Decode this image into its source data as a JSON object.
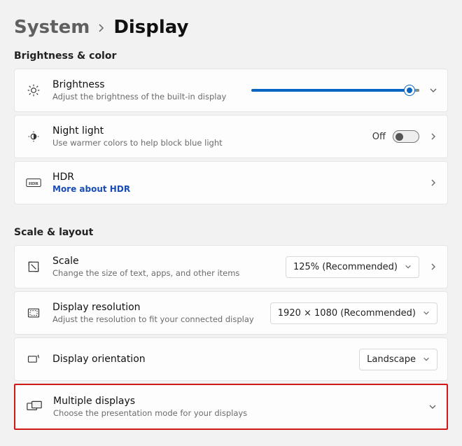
{
  "breadcrumb": {
    "parent": "System",
    "current": "Display"
  },
  "sections": {
    "brightness_color": "Brightness & color",
    "scale_layout": "Scale & layout"
  },
  "brightness": {
    "title": "Brightness",
    "subtitle": "Adjust the brightness of the built-in display",
    "value_pct": 94
  },
  "night_light": {
    "title": "Night light",
    "subtitle": "Use warmer colors to help block blue light",
    "state_label": "Off",
    "enabled": false
  },
  "hdr": {
    "title": "HDR",
    "link": "More about HDR"
  },
  "scale": {
    "title": "Scale",
    "subtitle": "Change the size of text, apps, and other items",
    "value": "125% (Recommended)"
  },
  "resolution": {
    "title": "Display resolution",
    "subtitle": "Adjust the resolution to fit your connected display",
    "value": "1920 × 1080 (Recommended)"
  },
  "orientation": {
    "title": "Display orientation",
    "value": "Landscape"
  },
  "multiple_displays": {
    "title": "Multiple displays",
    "subtitle": "Choose the presentation mode for your displays"
  }
}
